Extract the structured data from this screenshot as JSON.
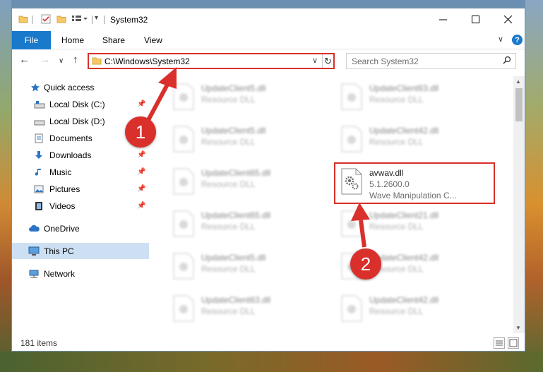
{
  "window": {
    "title": "System32"
  },
  "ribbon": {
    "tabs": [
      "File",
      "Home",
      "Share",
      "View"
    ],
    "help": "?"
  },
  "address": {
    "path": "C:\\Windows\\System32"
  },
  "search": {
    "placeholder": "Search System32"
  },
  "sidebar": {
    "items": [
      {
        "label": "Quick access",
        "icon": "star-icon",
        "pinned": false
      },
      {
        "label": "Local Disk (C:)",
        "icon": "drive-icon",
        "pinned": true
      },
      {
        "label": "Local Disk (D:)",
        "icon": "drive-icon",
        "pinned": false
      },
      {
        "label": "Documents",
        "icon": "documents-icon",
        "pinned": true
      },
      {
        "label": "Downloads",
        "icon": "download-icon",
        "pinned": true
      },
      {
        "label": "Music",
        "icon": "music-icon",
        "pinned": true
      },
      {
        "label": "Pictures",
        "icon": "pictures-icon",
        "pinned": true
      },
      {
        "label": "Videos",
        "icon": "videos-icon",
        "pinned": true
      },
      {
        "label": "OneDrive",
        "icon": "cloud-icon",
        "pinned": false
      },
      {
        "label": "This PC",
        "icon": "computer-icon",
        "pinned": false,
        "active": true
      },
      {
        "label": "Network",
        "icon": "network-icon",
        "pinned": false
      }
    ]
  },
  "files": {
    "left": [
      {
        "name": "UpdateClient5.dll",
        "type": "Resource DLL"
      },
      {
        "name": "UpdateClient5.dll",
        "type": "Resource DLL"
      },
      {
        "name": "UpdateClient65.dll",
        "type": "Resource DLL"
      },
      {
        "name": "UpdateClient65.dll",
        "type": "Resource DLL"
      },
      {
        "name": "UpdateClient5.dll",
        "type": "Resource DLL"
      },
      {
        "name": "UpdateClient63.dll",
        "type": "Resource DLL"
      }
    ],
    "right": [
      {
        "name": "UpdateClient63.dll",
        "type": "Resource DLL"
      },
      {
        "name": "UpdateClient42.dll",
        "type": "Resource DLL"
      },
      {
        "name": "UpdateClient21.dll",
        "type": "Resource DLL"
      },
      {
        "name": "UpdateClient42.dll",
        "type": "Resource DLL"
      },
      {
        "name": "UpdateClient42.dll",
        "type": "Resource DLL"
      }
    ],
    "selected": {
      "name": "avwav.dll",
      "version": "5.1.2600.0",
      "description": "Wave Manipulation C..."
    }
  },
  "status": {
    "count": "181 items"
  },
  "callouts": {
    "one": "1",
    "two": "2"
  },
  "colors": {
    "accent": "#1979ca",
    "callout": "#d9302c",
    "selection": "#cde0f3"
  }
}
